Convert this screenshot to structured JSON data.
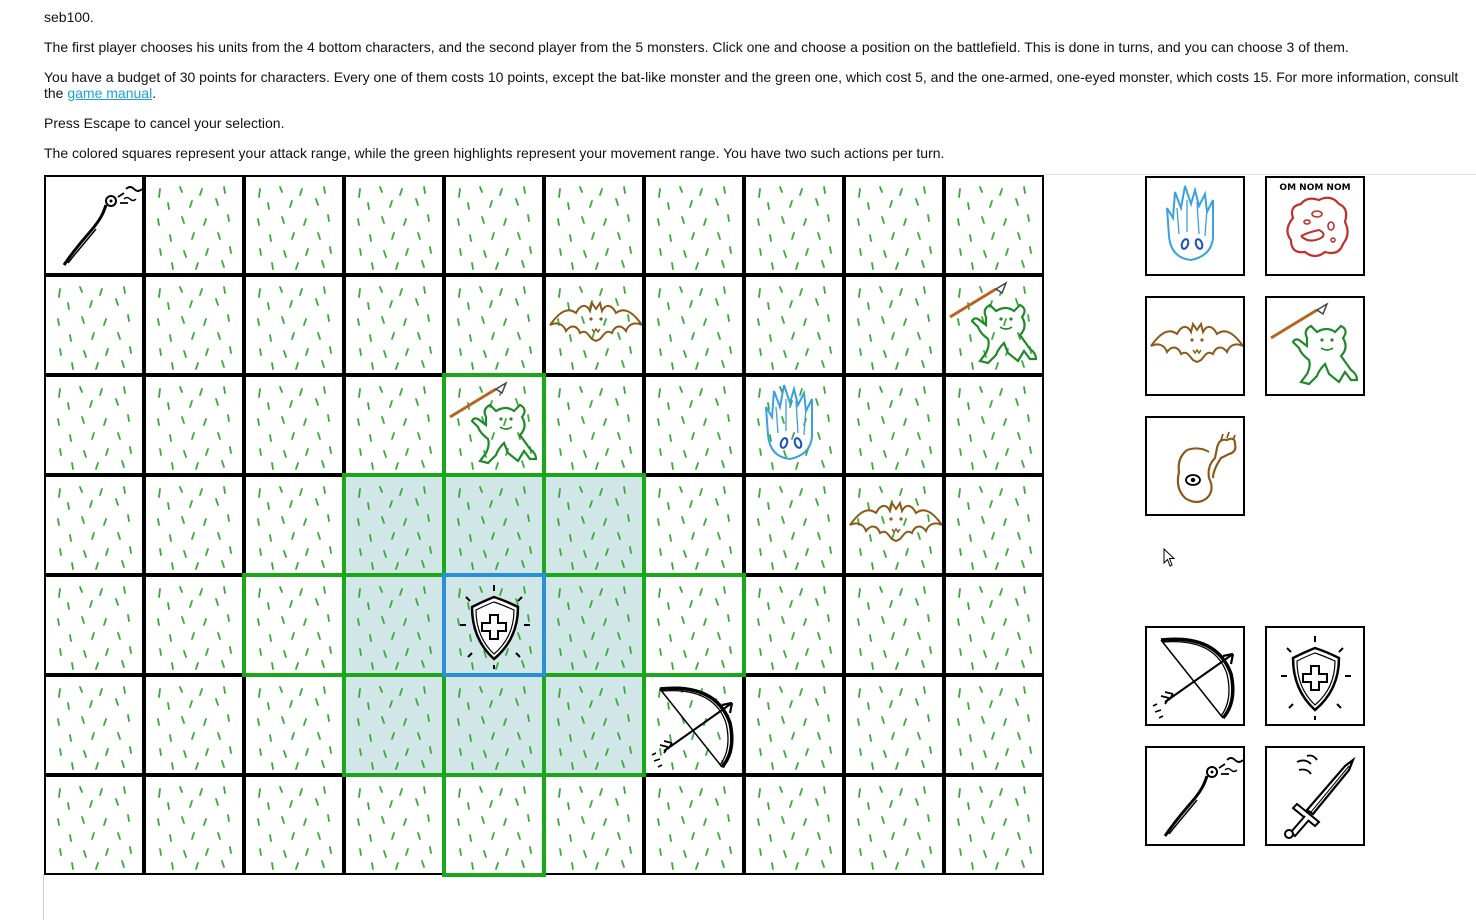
{
  "text": {
    "line1": "seb100.",
    "line2": "The first player chooses his units from the 4 bottom characters, and the second player from the 5 monsters. Click one and choose a position on the battlefield. This is done in turns, and you can choose 3 of them.",
    "line3_pre": "You have a budget of 30 points for characters. Every one of them costs 10 points, except the bat-like monster and the green one, which cost 5, and the one-armed, one-eyed monster, which costs 15. For more information, consult the ",
    "line3_link": "game manual",
    "line3_post": ".",
    "line4": "Press Escape to cancel your selection.",
    "line5": "The colored squares represent your attack range, while the green highlights represent your movement range. You have two such actions per turn."
  },
  "board": {
    "cols": 10,
    "rows": 7,
    "empty_cells": [
      [
        0,
        0
      ]
    ],
    "attack_cells": [
      [
        3,
        3
      ],
      [
        4,
        3
      ],
      [
        5,
        3
      ],
      [
        3,
        4
      ],
      [
        5,
        4
      ],
      [
        3,
        5
      ],
      [
        4,
        5
      ],
      [
        5,
        5
      ],
      [
        4,
        4
      ]
    ],
    "move_outline_cells": [
      [
        4,
        2
      ],
      [
        3,
        3
      ],
      [
        4,
        3
      ],
      [
        5,
        3
      ],
      [
        2,
        4
      ],
      [
        3,
        4
      ],
      [
        5,
        4
      ],
      [
        6,
        4
      ],
      [
        3,
        5
      ],
      [
        4,
        5
      ],
      [
        5,
        5
      ],
      [
        4,
        6
      ]
    ],
    "selected_cell": [
      4,
      4
    ],
    "units": [
      {
        "col": 0,
        "row": 0,
        "icon": "whip-icon"
      },
      {
        "col": 5,
        "row": 1,
        "icon": "bat-monster-icon"
      },
      {
        "col": 9,
        "row": 1,
        "icon": "spear-goblin-icon"
      },
      {
        "col": 4,
        "row": 2,
        "icon": "spear-goblin-icon"
      },
      {
        "col": 7,
        "row": 2,
        "icon": "ice-crystal-monster-icon"
      },
      {
        "col": 8,
        "row": 3,
        "icon": "bat-monster-icon"
      },
      {
        "col": 4,
        "row": 4,
        "icon": "shield-icon"
      },
      {
        "col": 6,
        "row": 5,
        "icon": "bow-icon"
      }
    ]
  },
  "monster_picker": [
    {
      "icon": "ice-crystal-monster-icon"
    },
    {
      "icon": "red-blob-monster-icon",
      "caption": "OM NOM NOM"
    },
    {
      "icon": "bat-monster-icon"
    },
    {
      "icon": "spear-goblin-icon"
    },
    {
      "icon": "one-eyed-arm-monster-icon"
    }
  ],
  "character_picker": [
    {
      "icon": "bow-icon"
    },
    {
      "icon": "shield-icon"
    },
    {
      "icon": "whip-icon"
    },
    {
      "icon": "sword-icon"
    }
  ],
  "colors": {
    "grass": "#3aa83a",
    "attack_fill": "#d1e6e6",
    "move_outline": "#1aa81a",
    "selected_outline": "#2b8fd6",
    "link": "#1aa3d6",
    "bat": "#8a5a1a",
    "goblin": "#1f8a2a",
    "ice": "#3aa0e0",
    "blob": "#c0302a"
  }
}
